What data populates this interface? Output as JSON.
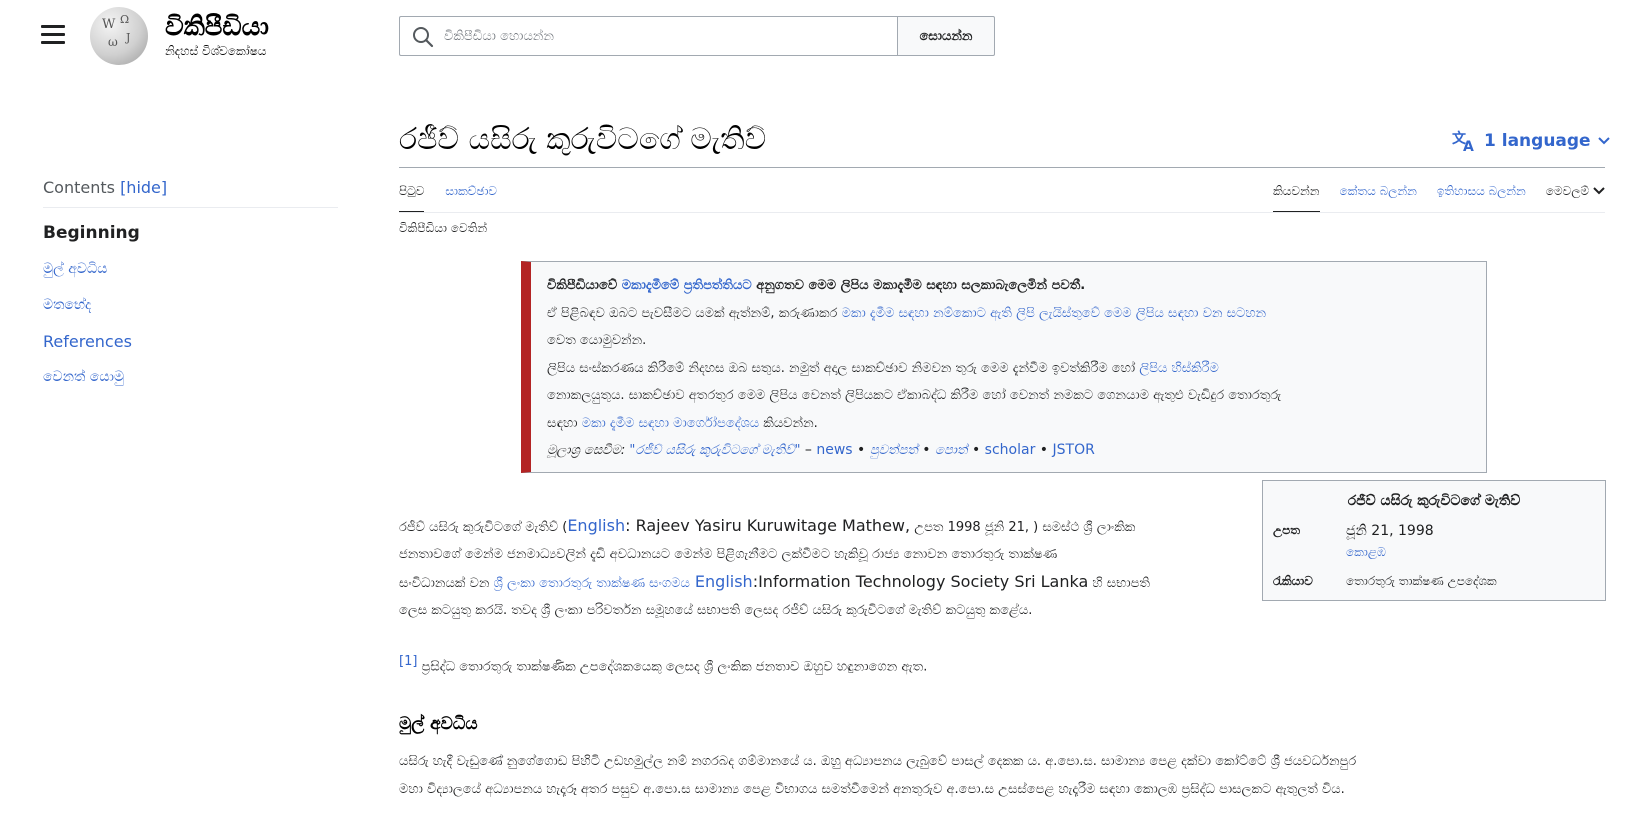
{
  "header": {
    "logo_word": "විකිපීඩියා",
    "logo_tagline": "නිදහස් විශ්වකෝෂය",
    "search_placeholder": "විකිපීඩියා හොයන්න",
    "search_button": "සොයන්න"
  },
  "toc": {
    "label": "Contents",
    "hide": "[hide]",
    "items": [
      "Beginning",
      "මුල් අවධිය",
      "මතභේද",
      "References",
      "වෙනත් යොමු"
    ]
  },
  "page": {
    "title": "රජීව් යසිරු කුරුවිටගේ මැතිව්",
    "language_button": "1 language",
    "from_wiki": "විකිපීඩියා වෙතින්"
  },
  "tabs": {
    "left": [
      "පිටුව",
      "සාකච්ඡාව"
    ],
    "right": [
      "කියවන්න",
      "කේතය බලන්න",
      "ඉතිහාසය බලන්න",
      "මෙවලම්"
    ]
  },
  "ambox": {
    "l1_a": "විකිපීඩියාවේ ",
    "l1_link": "මකාදැමීමේ ප්‍රතිපත්තියට",
    "l1_b": " අනුගතව මෙම ලිපිය මකාදැමීම සඳහා සලකාබැලෙමින් පවතී.",
    "l2_a": "ඒ පිළිබඳව ඔබට පැවසීමට යමක් ඇත්නම්, කරුණාකර ",
    "l2_link": "මකා දැමීම සඳහා නම්කොට ඇති ලිපි ලැයිස්තුවේ මෙම ලිපිය සඳහා වන සටහන",
    "l3": "වෙත යොමුවන්න.",
    "l4_a": "ලිපිය සංස්කරණය කිරීමේ නිදහස ඔබ සතුය. නමුත් අදාල සාකච්ඡාව නිමවන තුරු මෙම දැන්වීම ඉවත්කිරීම හෝ ",
    "l4_link": "ලිපිය හිස්කිරීම",
    "l5": "නොකලයුතුය. සාකච්ඡාව අතරතුර මෙම ලිපිය වෙනත් ලිපියකට ඒකාබද්ධ කිරීම හෝ වෙනත් නමකට ගෙනයාම ඇතුළු වැඩිදුර තොරතුරු",
    "l6_a": "සඳහා ",
    "l6_link": "මකා දැමීම සඳහා මාර්ගෝපදේශය",
    "l6_b": " කියවන්න.",
    "src_label": "මූලාශ්‍ර සෙවීම: ",
    "src_query": "\"රජීව් යසිරු කුරුවිටගේ මැතිව්\"",
    "src_dash": " – ",
    "src_news": "news",
    "src_bullet": " • ",
    "src_papers": "පුවත්පත්",
    "src_books": "පොත්",
    "src_scholar": "scholar",
    "src_jstor": "JSTOR"
  },
  "infobox": {
    "title": "රජීව් යසිරු කුරුවිටගේ මැතිව්",
    "born_label": "උපත",
    "born_date": "ජූනි 21, 1998",
    "born_place": "කොළඹ",
    "job_label": "රැකියාව",
    "job_value": "තොරතුරු තාක්ෂණ උපදේශක"
  },
  "body": {
    "p1_a": "රජීව් යසිරු කුරුවිටගේ මැතිව් (",
    "p1_en_link": "English",
    "p1_en_text": ": Rajeev Yasiru Kuruwitage Mathew,",
    "p1_b": " උපත 1998 ජූනි 21, ) සමස්ථ ශ්‍රී ලාංකික",
    "p1_l2": "ජනතාවගේ මෙන්ම ජනමාධ්‍යවලින් දැඩි අවධානයට මෙන්ම පිළිගැනීමට ලක්වීමට හැකිවූ රාජ්‍ය නොවන තොරතුරු තාක්ෂණ",
    "p1_l3_a": "සංවිධානයක් වන ",
    "p1_l3_link": "ශ්‍රී ලංකා තොරතුරු තාක්ෂණ සංගමය",
    "p1_l3_en_link": " English",
    "p1_l3_en_text": ":Information Technology Society Sri Lanka",
    "p1_l3_b": " හි සභාපති",
    "p1_l4": "ලෙස කටයුතු කරයි. තවද ශ්‍රී ලංකා පරිවර්තන සමූහයේ සභාපති ලෙසද රජීව් යසිරු කුරුවිටගේ මැතිව් කටයුතු කළේය.",
    "p2_ref": "[1]",
    "p2": " ප්‍රසිද්ධ තොරතුරු තාක්ෂණික උපදේශකයෙකු ලෙසද ශ්‍රී ලංකික ජනතාව ඔහුව හඳුනාගෙන ඇත.",
    "h_early": "මුල් අවධිය",
    "p3_l1": "යසිරු හැදී වැඩුණේ නුගේගොඩ පිහිටි උඩහමුල්ල නම් නගරබද ගම්මානයේ ය. ඔහු අධ්‍යාපනය ලැබුවේ පාසල් දෙකක ය. අ.පො.ස. සාමාන්‍ය පෙළ දක්වා කෝට්ටේ ශ්‍රී ජයවර්ධනපුර",
    "p3_l2": "මහා විද්‍යාලයේ අධ්‍යාපනය හැදෑරූ අතර පසුව අ.පො.ස සාමාන්‍ය පෙළ විභාගය සමත්වීමෙන් අනතුරුව අ.පො.ස උසස්පෙළ හැදෑරීම සඳහා කොලඹ ප්‍රසිද්ධ පාසලකට ඇතුලත් විය."
  },
  "colors": {
    "link": "#3366cc",
    "ambox_border": "#b32424",
    "rule": "#a2a9b1"
  }
}
